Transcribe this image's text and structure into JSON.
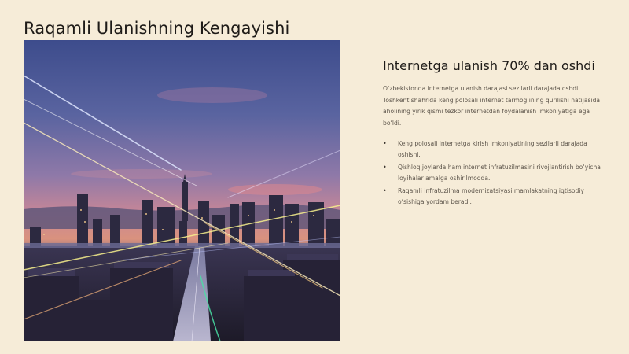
{
  "slide": {
    "title": "Raqamli Ulanishning Kengayishi"
  },
  "photo": {
    "subject": "city-skyline-dusk-light-trails"
  },
  "content": {
    "subheading": "Internetga ulanish 70% dan oshdi",
    "paragraph": "O‘zbekistonda internetga ulanish darajasi sezilarli darajada oshdi. Toshkent shahrida keng polosali internet tarmog‘ining qurilishi natijasida aholining yirik qismi tezkor internetdan foydalanish imkoniyatiga ega bo‘ldi.",
    "bullet_symbol": "•",
    "bullets": [
      "Keng polosali internetga kirish imkoniyatining sezilarli darajada oshishi.",
      "Qishloq joylarda ham internet infratuzilmasini rivojlantirish bo‘yicha loyihalar amalga oshirilmoqda.",
      "Raqamli infratuzilma modernizatsiyasi mamlakatning iqtisodiy o‘sishiga yordam beradi."
    ]
  },
  "colors": {
    "background": "#f6ecd8",
    "title_text": "#1e1b18",
    "body_text": "#5d554b"
  }
}
